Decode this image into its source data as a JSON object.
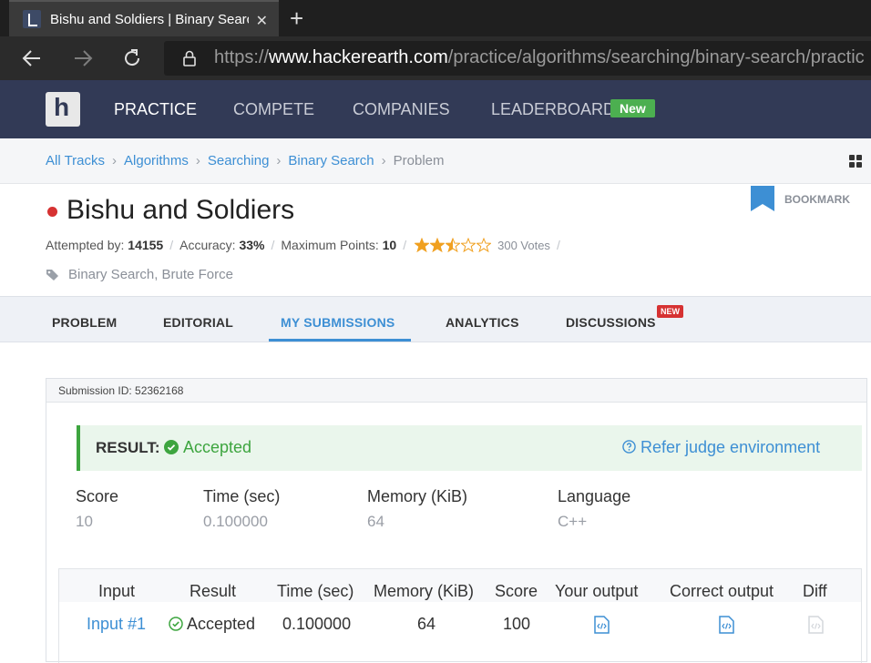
{
  "browser": {
    "tab_title": "Bishu and Soldiers | Binary Search",
    "url_scheme": "https://",
    "url_host": "www.hackerearth.com",
    "url_path": "/practice/algorithms/searching/binary-search/practic"
  },
  "sitenav": {
    "logo": "h",
    "items": [
      "PRACTICE",
      "COMPETE",
      "COMPANIES",
      "LEADERBOARD"
    ],
    "new_badge": "New"
  },
  "breadcrumb": [
    "All Tracks",
    "Algorithms",
    "Searching",
    "Binary Search",
    "Problem"
  ],
  "problem": {
    "title": "Bishu and Soldiers",
    "bookmark_label": "BOOKMARK",
    "attempted_label": "Attempted by:",
    "attempted": "14155",
    "accuracy_label": "Accuracy:",
    "accuracy": "33%",
    "max_points_label": "Maximum Points:",
    "max_points": "10",
    "rating_stars": 2.5,
    "votes": "300 Votes",
    "tags": "Binary Search, Brute Force"
  },
  "tabs": {
    "items": [
      "PROBLEM",
      "EDITORIAL",
      "MY SUBMISSIONS",
      "ANALYTICS",
      "DISCUSSIONS"
    ],
    "active": "MY SUBMISSIONS",
    "new_badge": "NEW"
  },
  "submission": {
    "id_label": "Submission ID: 52362168",
    "result_label": "RESULT:",
    "result": "Accepted",
    "refer_link": "Refer judge environment",
    "stats": [
      {
        "label": "Score",
        "value": "10"
      },
      {
        "label": "Time (sec)",
        "value": "0.100000"
      },
      {
        "label": "Memory (KiB)",
        "value": "64"
      },
      {
        "label": "Language",
        "value": "C++"
      }
    ],
    "table_headers": [
      "Input",
      "Result",
      "Time (sec)",
      "Memory (KiB)",
      "Score",
      "Your output",
      "Correct output",
      "Diff"
    ],
    "rows": [
      {
        "input": "Input #1",
        "result": "Accepted",
        "time": "0.100000",
        "memory": "64",
        "score": "100"
      }
    ]
  },
  "colors": {
    "nav_bg": "#323a56",
    "link": "#3d8fd4",
    "success": "#3da53f",
    "danger": "#d63232"
  }
}
